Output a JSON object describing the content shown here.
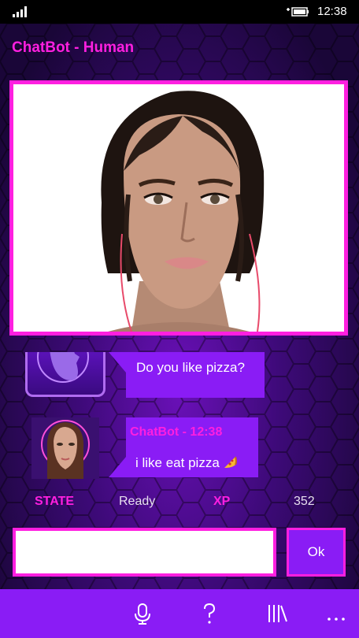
{
  "status_bar": {
    "time": "12:38"
  },
  "header": {
    "title": "ChatBot - Human"
  },
  "messages": {
    "user_text": "Do you like pizza?",
    "bot_header": "ChatBot - 12:38",
    "bot_text": "i like eat pizza"
  },
  "stats": {
    "state_label": "STATE",
    "state_value": "Ready",
    "xp_label": "XP",
    "xp_value": "352"
  },
  "input": {
    "value": "",
    "ok_label": "Ok"
  },
  "appbar": {
    "icons": [
      "microphone-icon",
      "help-icon",
      "library-icon",
      "more-icon"
    ]
  },
  "colors": {
    "accent": "#ff1fe0",
    "bubble": "#8a1cf5",
    "background": "#3d0a78"
  }
}
